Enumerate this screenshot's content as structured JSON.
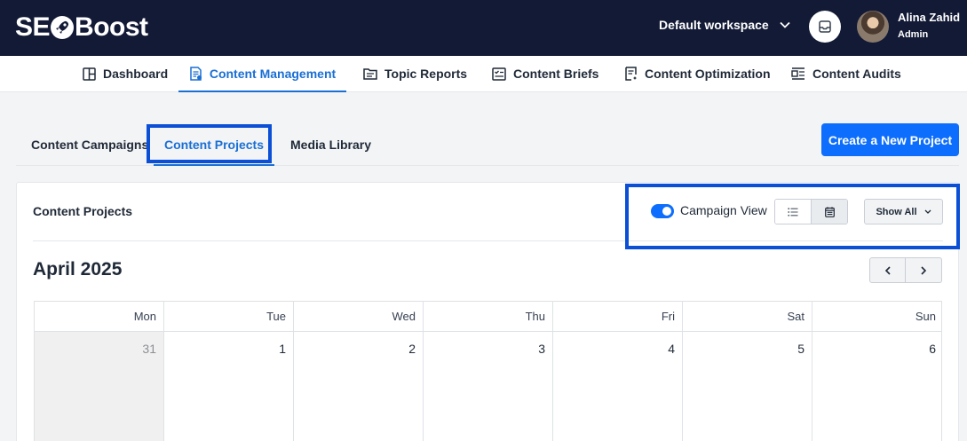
{
  "header": {
    "logo": {
      "left": "SE",
      "right": "Boost"
    },
    "workspace": "Default workspace",
    "user": {
      "name": "Alina Zahid",
      "role": "Admin"
    }
  },
  "nav": {
    "items": [
      {
        "label": "Dashboard",
        "icon": "dashboard-icon"
      },
      {
        "label": "Content Management",
        "icon": "content-management-icon",
        "active": true
      },
      {
        "label": "Topic Reports",
        "icon": "topic-reports-icon"
      },
      {
        "label": "Content Briefs",
        "icon": "content-briefs-icon"
      },
      {
        "label": "Content Optimization",
        "icon": "content-optimization-icon"
      },
      {
        "label": "Content Audits",
        "icon": "content-audits-icon"
      }
    ]
  },
  "subtabs": {
    "items": [
      {
        "label": "Content Campaigns"
      },
      {
        "label": "Content Projects",
        "active": true
      },
      {
        "label": "Media Library"
      }
    ],
    "create_button": "Create a New Project"
  },
  "projects": {
    "title": "Content Projects",
    "campaign_view_label": "Campaign View",
    "campaign_view_on": true,
    "show_all_label": "Show All",
    "month_title": "April 2025",
    "weekdays": [
      "Mon",
      "Tue",
      "Wed",
      "Thu",
      "Fri",
      "Sat",
      "Sun"
    ],
    "days": [
      "31",
      "1",
      "2",
      "3",
      "4",
      "5",
      "6"
    ]
  },
  "colors": {
    "header_bg": "#131a36",
    "accent": "#1a6fd4",
    "primary_button": "#0d6efd",
    "highlight_box": "#0b4fd6"
  }
}
